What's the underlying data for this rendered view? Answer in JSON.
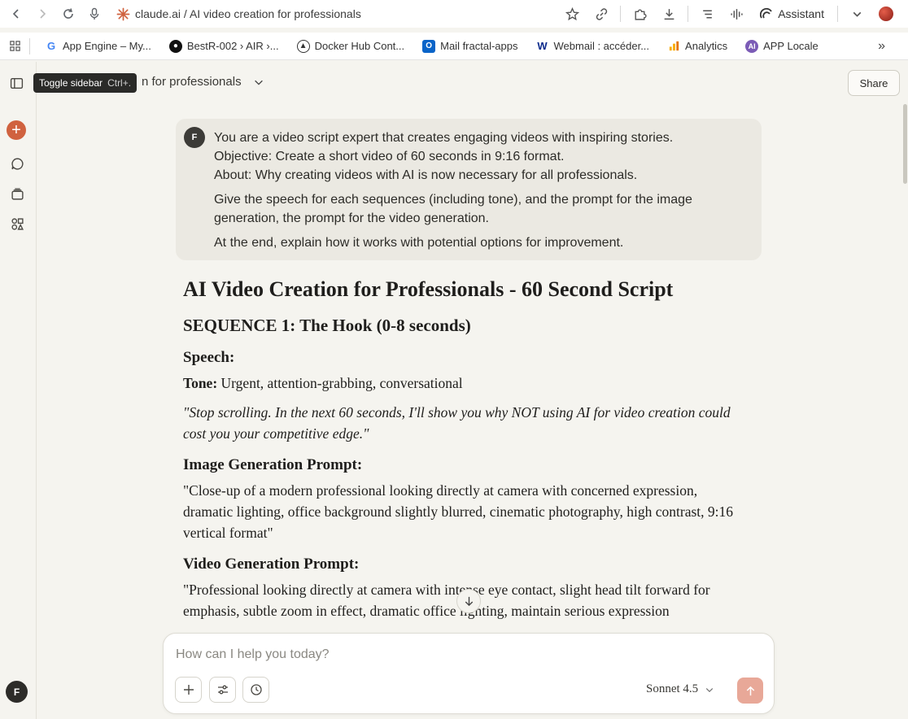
{
  "browser": {
    "url_text": "claude.ai / AI video creation for professionals",
    "assistant_label": "Assistant"
  },
  "bookmarks": [
    {
      "label": "App Engine – My...",
      "icon": "google-icon"
    },
    {
      "label": "BestR-002 › AIR ›...",
      "icon": "github-icon"
    },
    {
      "label": "Docker Hub Cont...",
      "icon": "docker-icon"
    },
    {
      "label": "Mail fractal-apps",
      "icon": "outlook-icon"
    },
    {
      "label": "Webmail : accéder...",
      "icon": "ovh-icon"
    },
    {
      "label": "Analytics",
      "icon": "analytics-icon"
    },
    {
      "label": "APP Locale",
      "icon": "ai-icon"
    }
  ],
  "sidebar": {
    "tooltip_label": "Toggle sidebar",
    "tooltip_shortcut": "Ctrl+.",
    "user_initial": "F"
  },
  "header": {
    "chat_title": "n for professionals",
    "share_label": "Share"
  },
  "user_message": {
    "initial": "F",
    "line1": "You are a video script expert that creates engaging videos with inspiring stories.",
    "line2": "Objective: Create a short video of 60 seconds in 9:16 format.",
    "line3": "About: Why creating videos with AI is now necessary for all professionals.",
    "para2": "Give the speech for each sequences (including tone), and the prompt for the image generation, the prompt for the video generation.",
    "para3": "At the end, explain how it works with potential options for improvement."
  },
  "response": {
    "title": "AI Video Creation for Professionals - 60 Second Script",
    "sequence1_heading": "SEQUENCE 1: The Hook (0-8 seconds)",
    "speech_heading": "Speech:",
    "tone_label": "Tone:",
    "tone_value": " Urgent, attention-grabbing, conversational",
    "speech_quote": "\"Stop scrolling. In the next 60 seconds, I'll show you why NOT using AI for video creation could cost you your competitive edge.\"",
    "image_prompt_heading": "Image Generation Prompt:",
    "image_prompt_text": "\"Close-up of a modern professional looking directly at camera with concerned expression, dramatic lighting, office background slightly blurred, cinematic photography, high contrast, 9:16 vertical format\"",
    "video_prompt_heading": "Video Generation Prompt:",
    "video_prompt_text": "\"Professional looking directly at camera with intense eye contact, slight head tilt forward for emphasis, subtle zoom in effect, dramatic office lighting, maintain serious expression"
  },
  "composer": {
    "placeholder": "How can I help you today?",
    "model_label": "Sonnet 4.5"
  },
  "colors": {
    "accent": "#d0623f",
    "send_button": "#e8a898",
    "background": "#f5f4ef",
    "user_bubble": "#ebe9e2"
  }
}
